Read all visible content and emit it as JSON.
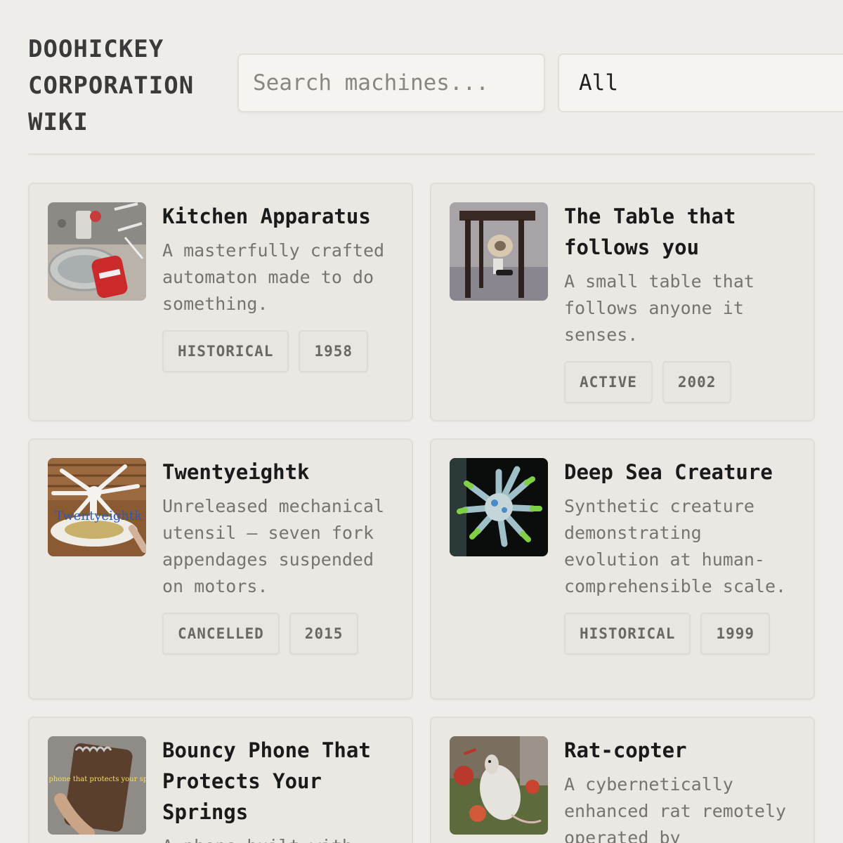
{
  "header": {
    "title": "DOOHICKEY CORPORATION WIKI",
    "search_placeholder": "Search machines...",
    "filter_value": "All"
  },
  "machines": [
    {
      "name": "Kitchen Apparatus",
      "description": "A masterfully crafted automaton made to do something.",
      "status": "HISTORICAL",
      "year": "1958"
    },
    {
      "name": "The Table that follows you",
      "description": "A small table that follows anyone it senses.",
      "status": "ACTIVE",
      "year": "2002"
    },
    {
      "name": "Twentyeightk",
      "description": "Unreleased mechanical utensil — seven fork appendages suspended on motors.",
      "status": "CANCELLED",
      "year": "2015",
      "image_text": "Twentyeightk"
    },
    {
      "name": "Deep Sea Creature",
      "description": "Synthetic creature demonstrating evolution at human-comprehensible scale.",
      "status": "HISTORICAL",
      "year": "1999"
    },
    {
      "name": "Bouncy Phone That Protects Your Springs",
      "description": "A phone built with",
      "status": "",
      "year": "",
      "image_text": "Bouncy phone that protects your springs !!"
    },
    {
      "name": "Rat-copter",
      "description": "A cybernetically enhanced rat remotely operated by",
      "status": "",
      "year": ""
    }
  ]
}
